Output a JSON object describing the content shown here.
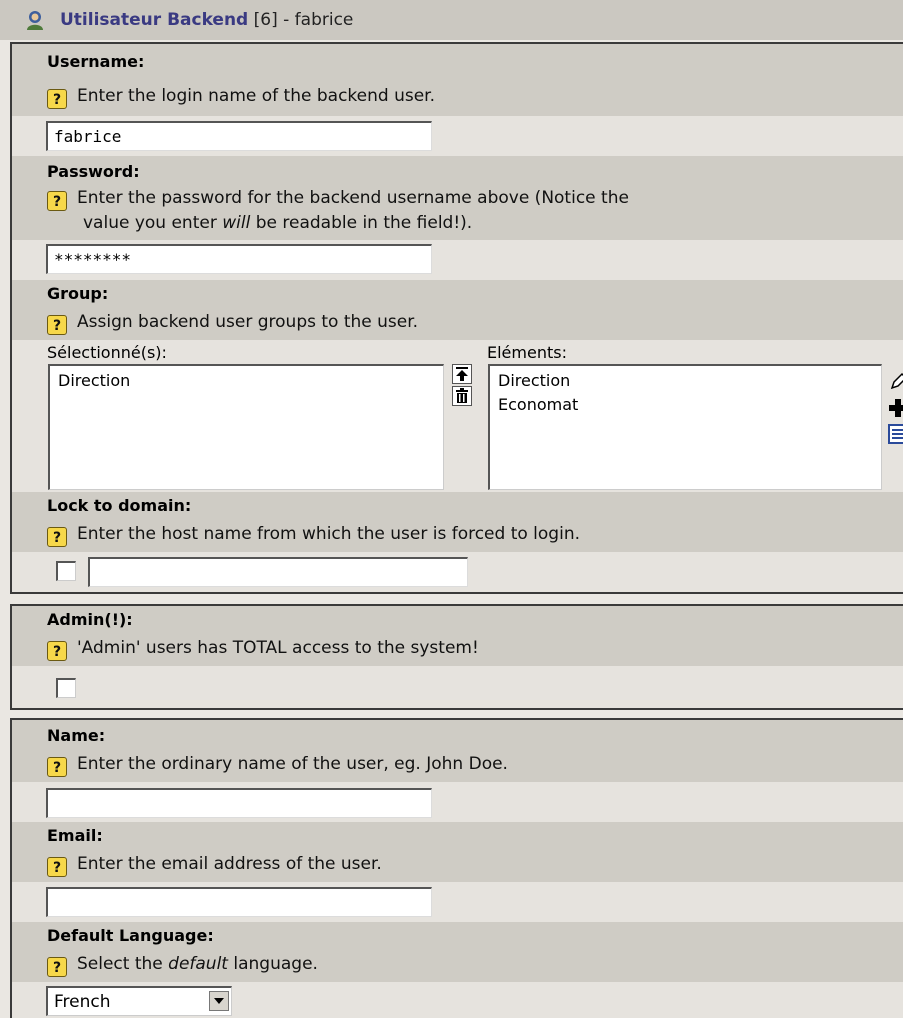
{
  "header": {
    "app_title": "Utilisateur Backend",
    "record_info": "[6] - fabrice"
  },
  "fields": {
    "username": {
      "label": "Username:",
      "help": "Enter the login name of the backend user.",
      "value": "fabrice"
    },
    "password": {
      "label": "Password:",
      "help_line1": "Enter the password for the backend username above (Notice the",
      "help_line2_pre": "value you enter ",
      "help_line2_em": "will",
      "help_line2_post": " be readable in the field!).",
      "value": "********"
    },
    "group": {
      "label": "Group:",
      "help": "Assign backend user groups to the user.",
      "selected_label": "Sélectionné(s):",
      "elements_label": "Eléments:",
      "selected_items": [
        "Direction"
      ],
      "available_items": [
        "Direction",
        "Economat"
      ]
    },
    "lock_to_domain": {
      "label": "Lock to domain:",
      "help": "Enter the host name from which the user is forced to login.",
      "value": ""
    },
    "admin": {
      "label": "Admin(!):",
      "help": "'Admin' users has TOTAL access to the system!"
    },
    "name": {
      "label": "Name:",
      "help": "Enter the ordinary name of the user, eg. John Doe.",
      "value": ""
    },
    "email": {
      "label": "Email:",
      "help": "Enter the email address of the user.",
      "value": ""
    },
    "default_language": {
      "label": "Default Language:",
      "help_pre": "Select the ",
      "help_em": "default",
      "help_post": " language.",
      "value": "French"
    }
  },
  "help_icon_glyph": "?",
  "colors": {
    "title_accent": "#3a3a82",
    "label_row_bg": "#cfccc5",
    "field_row_bg": "#e6e3de",
    "help_icon": "#f7d84a"
  }
}
